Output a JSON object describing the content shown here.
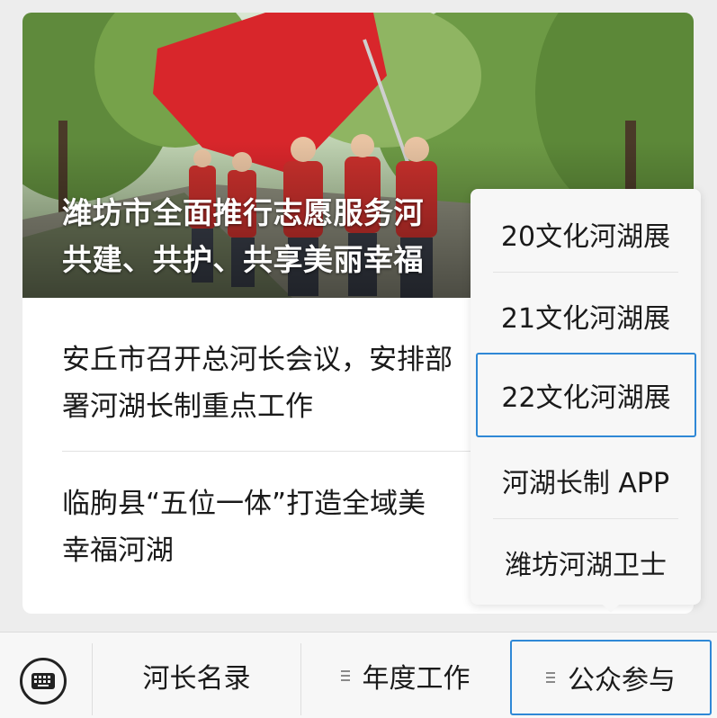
{
  "featured": {
    "title_line1": "潍坊市全面推行志愿服务河",
    "title_line2": "共建、共护、共享美丽幸福"
  },
  "articles": [
    {
      "line1": "安丘市召开总河长会议，安排部",
      "line2": "署河湖长制重点工作"
    },
    {
      "line1": "临朐县“五位一体”打造全域美",
      "line2": "幸福河湖"
    }
  ],
  "popup_menu": {
    "items": [
      {
        "label": "20文化河湖展"
      },
      {
        "label": "21文化河湖展"
      },
      {
        "label": "22文化河湖展"
      },
      {
        "label": "河湖长制 APP"
      },
      {
        "label": "潍坊河湖卫士"
      }
    ],
    "selected_index": 2
  },
  "bottom_bar": {
    "keyboard_icon": "keyboard-icon",
    "tabs": [
      {
        "label": "河长名录",
        "has_menu_icon": false
      },
      {
        "label": "年度工作",
        "has_menu_icon": true
      },
      {
        "label": "公众参与",
        "has_menu_icon": true
      }
    ],
    "active_tab_index": 2
  },
  "colors": {
    "selection_outline": "#2f88d6",
    "background": "#ededed",
    "popup_background": "#f7f7f7"
  }
}
